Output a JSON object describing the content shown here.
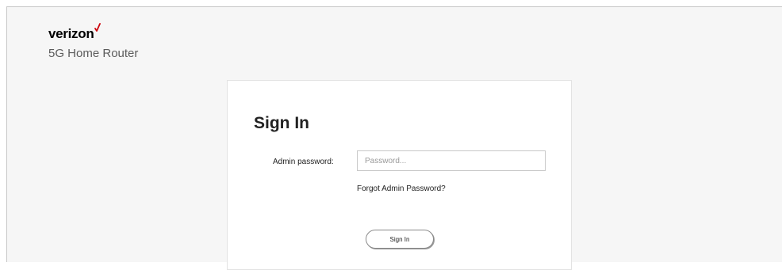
{
  "brand": {
    "logo_text": "verizon",
    "logo_mark": "red-checkmark",
    "accent_color": "#cd040b",
    "product_name": "5G Home Router"
  },
  "signin": {
    "title": "Sign In",
    "password_label": "Admin password:",
    "password_placeholder": "Password...",
    "password_value": "",
    "forgot_link": "Forgot Admin Password?",
    "submit_label": "Sign In"
  }
}
